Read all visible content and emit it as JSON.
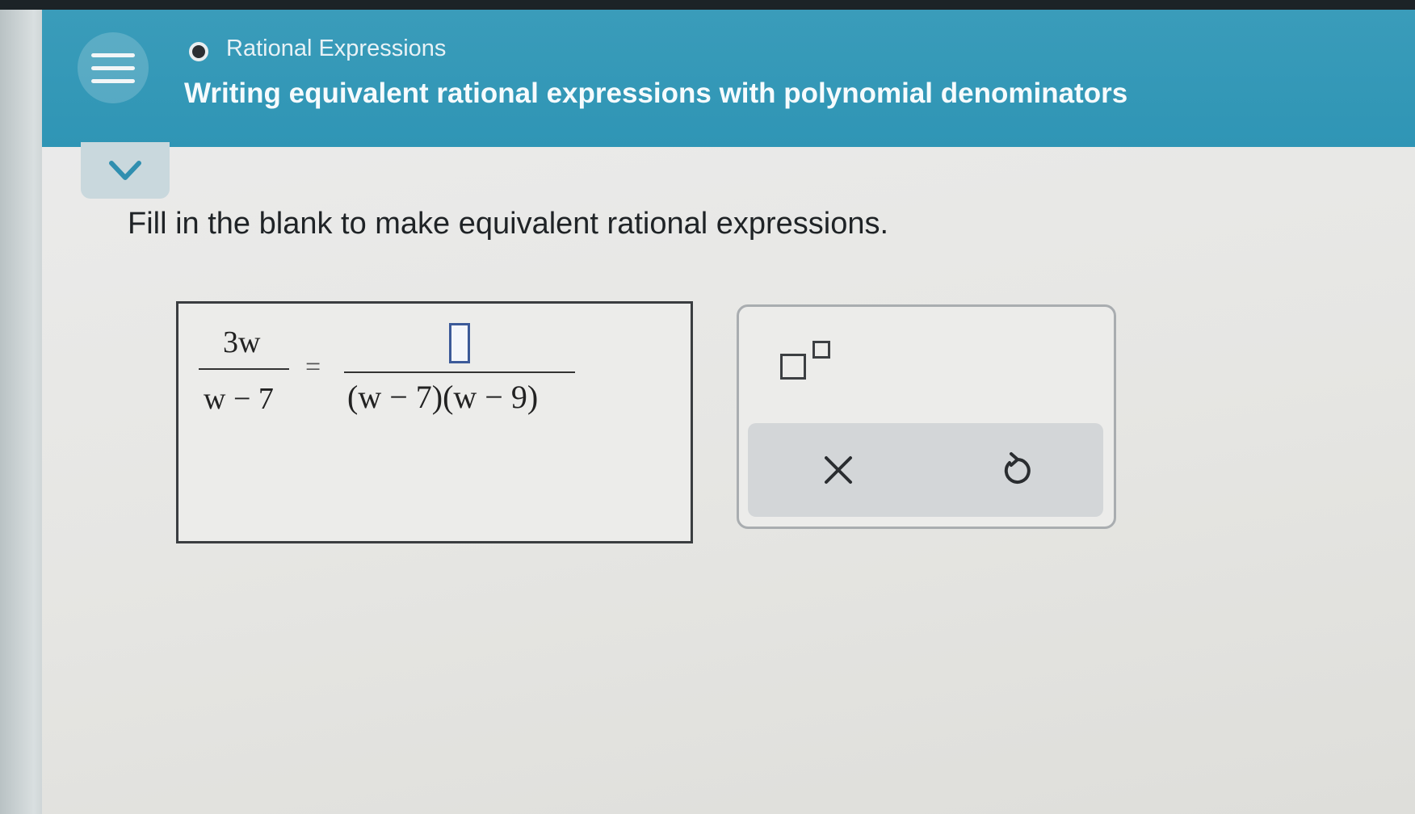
{
  "header": {
    "topic": "Rational Expressions",
    "subtopic": "Writing equivalent rational expressions with polynomial denominators"
  },
  "icons": {
    "menu": "hamburger-icon",
    "topic_status": "circle-icon",
    "collapse": "chevron-down-icon",
    "exponent": "superscript-icon",
    "clear": "close-icon",
    "undo": "undo-icon"
  },
  "problem": {
    "instruction": "Fill in the blank to make equivalent rational expressions.",
    "left_numerator": "3w",
    "left_denominator": "w − 7",
    "equals": "=",
    "right_numerator": "",
    "right_denominator": "(w − 7)(w − 9)"
  },
  "keypad": {
    "clear_label": "×"
  },
  "colors": {
    "header": "#3399b8",
    "text": "#1f2326",
    "blank_border": "#3c5a99"
  }
}
